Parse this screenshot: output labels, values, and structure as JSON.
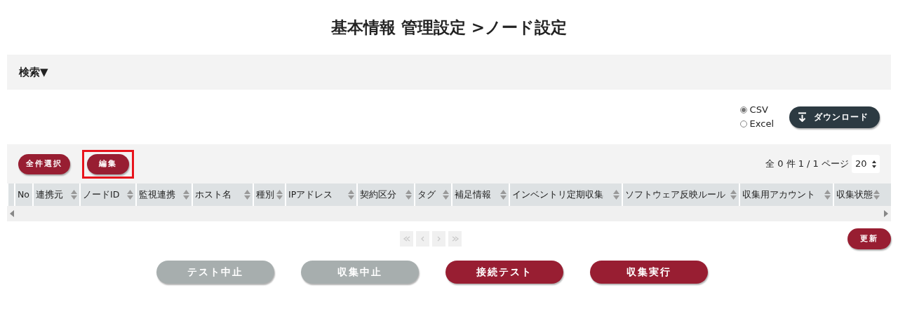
{
  "page_title": "基本情報 管理設定 >ノード設定",
  "search_panel": {
    "label": "検索▼"
  },
  "export": {
    "formats": [
      {
        "label": "CSV",
        "selected": true
      },
      {
        "label": "Excel",
        "selected": false
      }
    ],
    "download_button": "ダウンロード"
  },
  "toolbar": {
    "buttons": [
      {
        "label": "全件選択",
        "highlighted": false
      },
      {
        "label": "編集",
        "highlighted": true
      }
    ],
    "summary": "全 0 件 1 /  1 ページ",
    "page_size": "20"
  },
  "table": {
    "columns": [
      {
        "label": "No",
        "sortable": false
      },
      {
        "label": "連携元",
        "sortable": true
      },
      {
        "label": "ノードID",
        "sortable": true
      },
      {
        "label": "監視連携",
        "sortable": true
      },
      {
        "label": "ホスト名",
        "sortable": true
      },
      {
        "label": "種別",
        "sortable": true
      },
      {
        "label": "IPアドレス",
        "sortable": true
      },
      {
        "label": "契約区分",
        "sortable": true
      },
      {
        "label": "タグ",
        "sortable": true
      },
      {
        "label": "補足情報",
        "sortable": true
      },
      {
        "label": "インベントリ定期収集",
        "sortable": true
      },
      {
        "label": "ソフトウェア反映ルール",
        "sortable": true
      },
      {
        "label": "収集用アカウント",
        "sortable": true
      },
      {
        "label": "収集状態",
        "sortable": true
      }
    ]
  },
  "pagination": [
    {
      "kind": "first",
      "disabled": true
    },
    {
      "kind": "prev",
      "disabled": true
    },
    {
      "kind": "next",
      "disabled": true
    },
    {
      "kind": "last",
      "disabled": true
    }
  ],
  "refresh_button": "更新",
  "actions": [
    {
      "label": "テスト中止",
      "disabled": true
    },
    {
      "label": "収集中止",
      "disabled": true
    },
    {
      "label": "接続テスト",
      "disabled": false
    },
    {
      "label": "収集実行",
      "disabled": false
    }
  ]
}
